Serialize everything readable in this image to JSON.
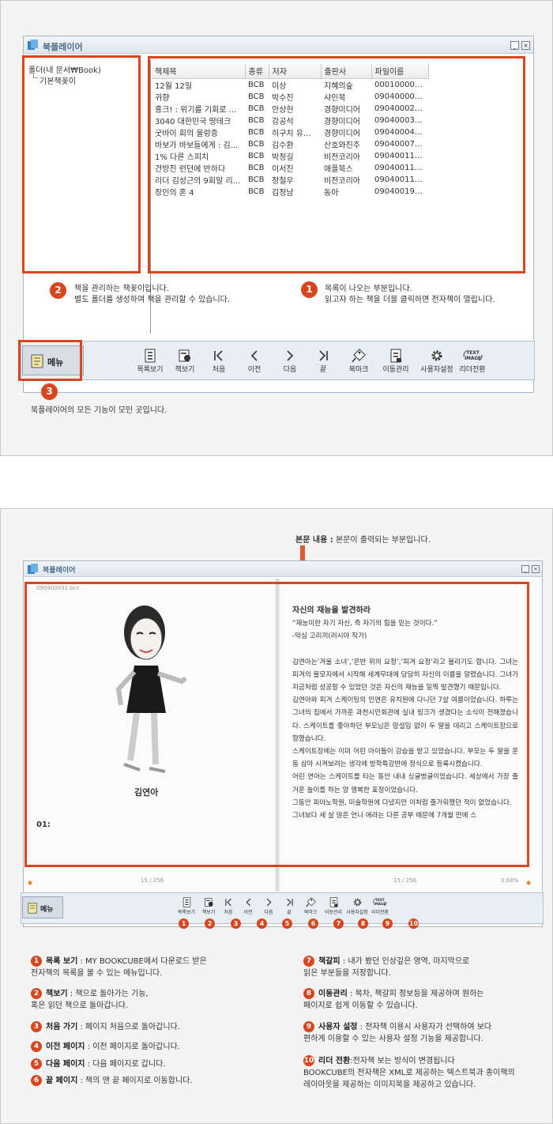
{
  "app_title": "북플레이어",
  "panel1": {
    "folders": [
      "폴더(내 문서₩Book)",
      "기본책꽂이"
    ],
    "table": {
      "headers": [
        "책제목",
        "종류",
        "저자",
        "출판사",
        "파일이름"
      ],
      "rows": [
        [
          "12월 12일",
          "BCB",
          "이상",
          "지혜의숲",
          "00010000..."
        ],
        [
          "귀향",
          "BCB",
          "박수진",
          "샤인북",
          "09040000..."
        ],
        [
          "홍크! : 위기를 기회로 ...",
          "BCB",
          "안상헌",
          "경향미디어",
          "09040002..."
        ],
        [
          "3040 대한민국 땅테크",
          "BCB",
          "강공석",
          "경향미디어",
          "09040003..."
        ],
        [
          "굿바이 회의 울렁증",
          "BCB",
          "히구치 유...",
          "경향미디어",
          "09040004..."
        ],
        [
          "바보가 바보들에게 : 김...",
          "BCB",
          "김수환",
          "산호와진주",
          "09040007..."
        ],
        [
          "1% 다른 스피치",
          "BCB",
          "박정길",
          "비전코리아",
          "09040011..."
        ],
        [
          "건방진 런던에 반하다",
          "BCB",
          "이서진",
          "애플북스",
          "09040011..."
        ],
        [
          "리더 김성근의 9회말 리...",
          "BCB",
          "정철우",
          "비전코리아",
          "09040011..."
        ],
        [
          "장인의 혼 4",
          "BCB",
          "김정남",
          "동아",
          "09040019..."
        ]
      ]
    },
    "callout1_num": "1",
    "callout1_text": "목록이 나오는 부분입니다.\n읽고자 하는 책을 더블 클릭하면 전자책이 열립니다.",
    "callout2_num": "2",
    "callout2_text": "책을 관리하는 책꽂이입니다.\n별도 폴더를 생성하여 책을 관리할 수 있습니다.",
    "callout3_num": "3",
    "callout3_text": "북플레이어의 모든 기능이 모인 곳입니다.",
    "menu_label": "메뉴"
  },
  "toolbar": {
    "buttons": [
      {
        "label": "목록보기",
        "icon": "list-icon"
      },
      {
        "label": "책보기",
        "icon": "book-view-icon"
      },
      {
        "label": "처음",
        "icon": "first-page-icon"
      },
      {
        "label": "이전",
        "icon": "prev-page-icon"
      },
      {
        "label": "다음",
        "icon": "next-page-icon"
      },
      {
        "label": "끝",
        "icon": "last-page-icon"
      },
      {
        "label": "북마크",
        "icon": "bookmark-icon"
      },
      {
        "label": "이동관리",
        "icon": "navigation-icon"
      },
      {
        "label": "사용자설정",
        "icon": "gear-icon"
      },
      {
        "label": "리더전환",
        "icon": "text-image-icon"
      }
    ],
    "reader_icon_top": "TEXT",
    "reader_icon_bottom": "IMAGE"
  },
  "panel2": {
    "body_label_bold": "본문 내용 :",
    "body_label_rest": " 본문이 출력되는 부분입니다.",
    "filename": "090400032.bcz",
    "figure_name": "김연아",
    "chapter_num": "01:",
    "page_left": "15 / 256",
    "page_right": "15 / 256",
    "zoom": "3.68%",
    "heading": "자신의 재능을 발견하라",
    "quote1": "“재능이란 자기 자신, 즉 자기의 힘을 믿는 것이다.”",
    "quote2": "-막심 고리끼(러시아 작가)",
    "body": "김연아는‘겨울 소녀’,‘은반 위의 요정’,‘피겨 요정’라고 불리기도 합니다. 그녀는 피겨의 불모지에서 시작해 세계무대에 당당히 자신의 이름을 알렸습니다. 그녀가 지금처럼 성공할 수 있었던 것은 자신의 재능을 일찍 발견했기 때문입니다.\n김연아와 피겨 스케이팅의 인연은 유치원에 다니던 7살 여름이었습니다. 하루는 그녀의 집에서 가까운 과천시민회관에 실내 링크가 생겼다는 소식이 전해졌습니다. 스케이트를 좋아하던 부모님은 망설임 없이 두 딸을 데리고 스케이트장으로 향했습니다.\n스케이트장에는 이미 어린 아이들이 강습을 받고 있었습니다. 부모는 두 딸을 운동 삼아 시켜보려는 생각에 방학특강반에 정식으로 등록시켰습니다.\n어린 연아는 스케이트를 타는 동안 내내 싱글벙글이었습니다. 세상에서 가장 즐거운 놀이를 하는 양 행복한 표정이었습니다.\n그동안 피아노학원, 미술학원에 다녔지만 이처럼 즐거워했던 적이 없었습니다.\n그녀보다 세 살 많은 언니 애라는 다른 공부 때문에 7개월 만에 스",
    "badges": [
      "1",
      "2",
      "3",
      "4",
      "5",
      "6",
      "7",
      "8",
      "9",
      "10"
    ]
  },
  "legend_left": [
    {
      "num": "1",
      "title": "목록 보기",
      "desc": " :  MY BOOKCUBE에서 다운로드 받은\n전자책의 목록을 볼 수 있는 메뉴입니다."
    },
    {
      "num": "2",
      "title": "책보기",
      "desc": " : 책으로 돌아가는 기능,\n혹은 읽던 책으로 돌아갑니다."
    },
    {
      "num": "3",
      "title": "처음 가기",
      "desc": " : 페이지 처음으로 돌아갑니다."
    },
    {
      "num": "4",
      "title": "이전 페이지",
      "desc": " : 이전 페이지로 돌아갑니다."
    },
    {
      "num": "5",
      "title": "다음 페이지",
      "desc": " : 다음 페이지로 갑니다."
    },
    {
      "num": "6",
      "title": "끝 페이지",
      "desc": " : 책의 맨 끝 페이지로 이동합니다."
    }
  ],
  "legend_right": [
    {
      "num": "7",
      "title": "책갈피",
      "desc": " : 내가 봤던 인상깊은 영역, 마지막으로\n읽은 부분들을 저장합니다."
    },
    {
      "num": "8",
      "title": "이동관리",
      "desc": " : 목차, 책갈피 정보등을 제공하며 원하는\n페이지로 쉽게 이동할 수 있습니다."
    },
    {
      "num": "9",
      "title": "사용자 설정",
      "desc": " : 전자책 이용시  사용자가 선택하여 보다\n편하게 이용할 수 있는 사용자 설정 기능을 제공합니다."
    },
    {
      "num": "10",
      "title": "리더 전환",
      "desc": ":전자책 보는 방식이 변경됩니다\nBOOKCUBE의 전자책은 XML로 제공하는 텍스트북과 종이책의\n레이아웃을 제공하는 이미지북을 제공하고 있습니다."
    }
  ],
  "colors": {
    "accent": "#d9461e",
    "window_border": "#aab6c2",
    "toolbar_bg": "#e7eef4"
  }
}
